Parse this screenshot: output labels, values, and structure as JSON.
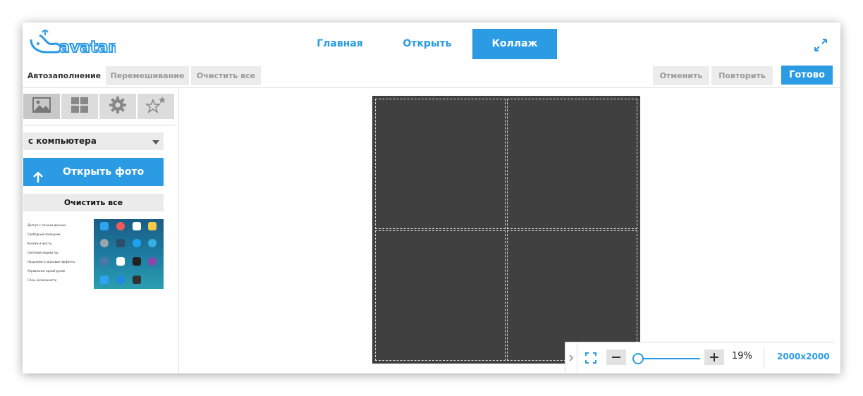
{
  "app": {
    "logo_text": "avatan",
    "brand_color": "#2b9be4"
  },
  "nav": {
    "home": "Главная",
    "open": "Открыть",
    "collage": "Коллаж"
  },
  "toolbar": {
    "autofill": "Автозаполнение",
    "shuffle": "Перемешивание",
    "clear_all": "Очистить все",
    "undo": "Отменить",
    "redo": "Повторить",
    "done": "Готово"
  },
  "sidebar": {
    "tabs": [
      {
        "icon": "image-icon",
        "active": true
      },
      {
        "icon": "layout-grid-icon",
        "active": false
      },
      {
        "icon": "gear-icon",
        "active": false
      },
      {
        "icon": "stars-icon",
        "active": false
      }
    ],
    "source_selected": "с компьютера",
    "open_photo": "Открыть фото",
    "clear_all": "Очистить все",
    "thumbnail_rows": [
      "Доступ к личным данным",
      "Свободный помощник",
      "Кнопки и жесты",
      "Световой индикатор",
      "Наушники и звуковые эффекты",
      "Управление одной рукой",
      "Спец. возможности"
    ]
  },
  "canvas": {
    "background": "#404040",
    "cells": 4
  },
  "zoom": {
    "percent": "19%",
    "value": 0.19,
    "size": "2000x2000"
  }
}
